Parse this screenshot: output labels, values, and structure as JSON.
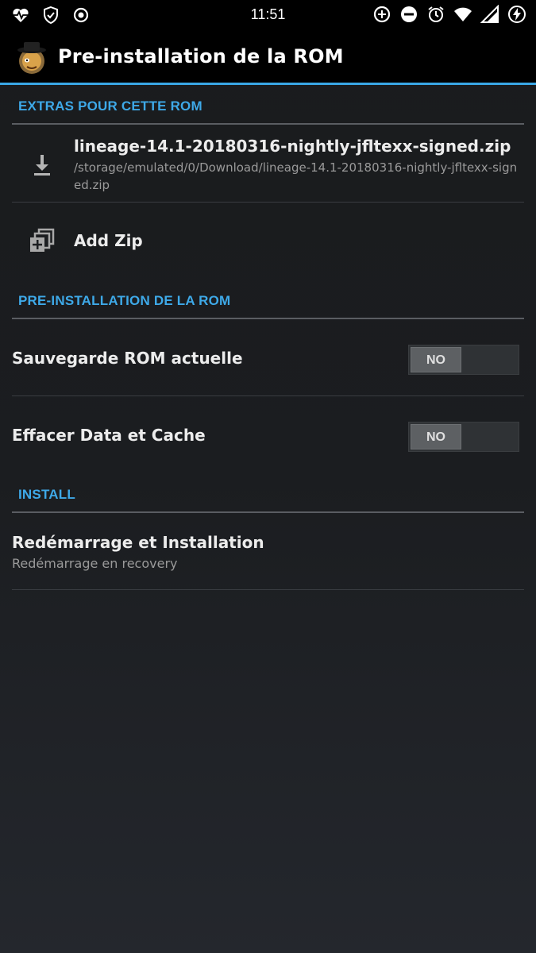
{
  "status_bar": {
    "time": "11:51",
    "left_icons": [
      "health-icon",
      "shield-check-icon",
      "record-icon"
    ],
    "right_icons": [
      "data-saver-icon",
      "do-not-disturb-icon",
      "alarm-icon",
      "wifi-icon",
      "signal-icon",
      "battery-charging-icon"
    ]
  },
  "header": {
    "title": "Pre-installation de la ROM",
    "logo": "clockwork-app-logo"
  },
  "sections": {
    "extras": {
      "title": "EXTRAS POUR CETTE ROM",
      "zip": {
        "name": "lineage-14.1-20180316-nightly-jfltexx-signed.zip",
        "path": "/storage/emulated/0/Download/lineage-14.1-20180316-nightly-jfltexx-signed.zip"
      },
      "add_zip_label": "Add Zip"
    },
    "preinstall": {
      "title": "PRE-INSTALLATION DE LA ROM",
      "backup": {
        "label": "Sauvegarde ROM actuelle",
        "toggle_text": "NO"
      },
      "wipe": {
        "label": "Effacer Data et Cache",
        "toggle_text": "NO"
      }
    },
    "install": {
      "title": "INSTALL",
      "reboot": {
        "title": "Redémarrage et Installation",
        "subtitle": "Redémarrage en recovery"
      }
    }
  },
  "colors": {
    "accent": "#3ea9e8",
    "background": "#1b1d20",
    "text_primary": "#ececec",
    "text_secondary": "#9a9a9a"
  }
}
